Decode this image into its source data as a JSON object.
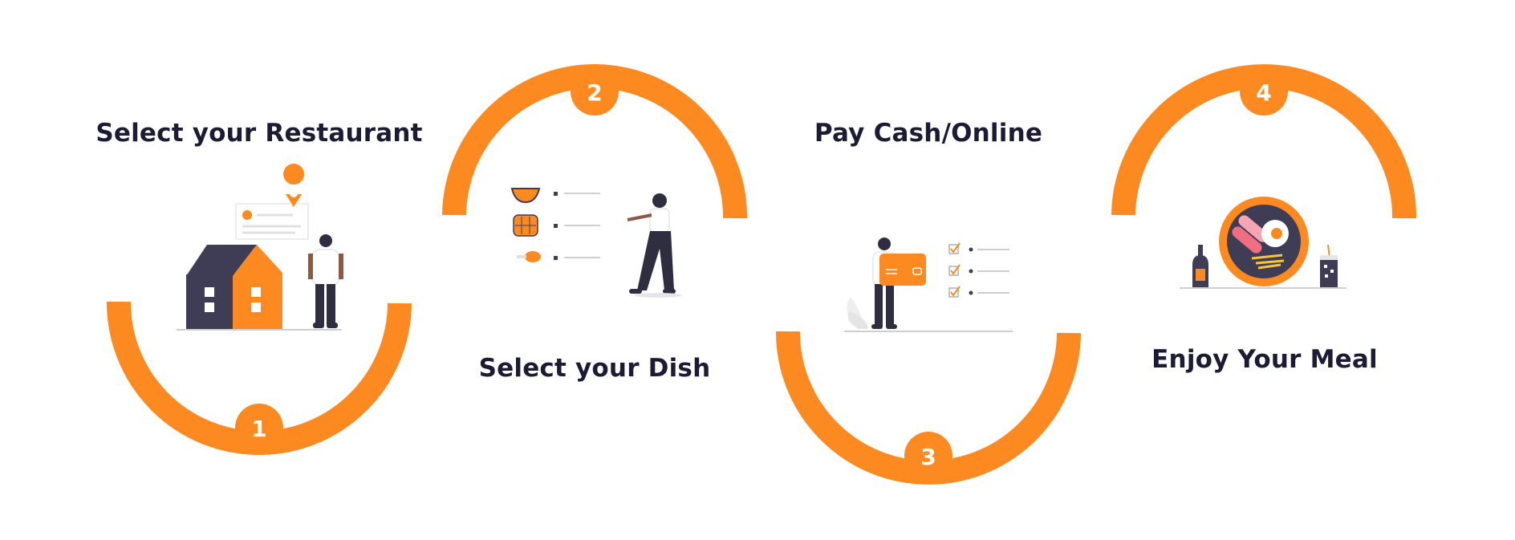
{
  "colors": {
    "accent": "#fd8a20",
    "dark": "#3f3d56",
    "title": "#1c1b35",
    "line": "#cfcfcf"
  },
  "steps": [
    {
      "number": "1",
      "title": "Select your Restaurant",
      "illustration": "restaurant-house-icon"
    },
    {
      "number": "2",
      "title": "Select your Dish",
      "illustration": "dish-menu-icon"
    },
    {
      "number": "3",
      "title": "Pay Cash/Online",
      "illustration": "payment-card-icon"
    },
    {
      "number": "4",
      "title": "Enjoy Your Meal",
      "illustration": "meal-plate-icon"
    }
  ]
}
